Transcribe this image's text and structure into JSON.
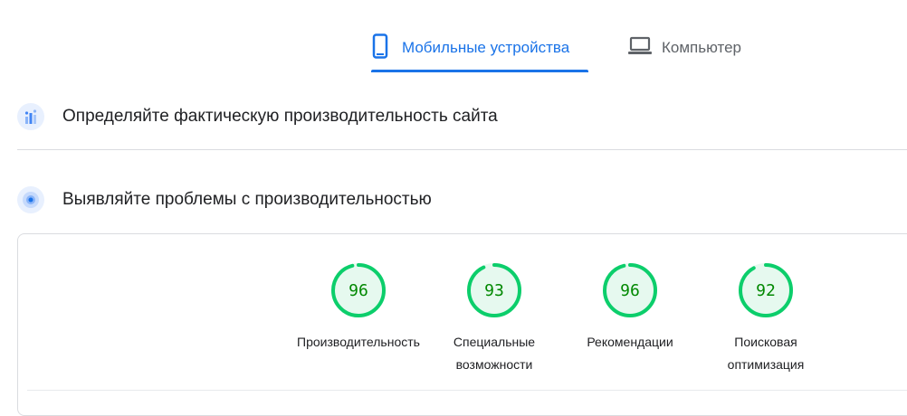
{
  "tabs": {
    "mobile": {
      "label": "Мобильные устройства",
      "icon": "smartphone-icon",
      "active": true
    },
    "desktop": {
      "label": "Компьютер",
      "icon": "laptop-icon",
      "active": false
    }
  },
  "sections": [
    {
      "title": "Определяйте фактическую производительность сайта",
      "icon": "field-data-icon"
    },
    {
      "title": "Выявляйте проблемы с производительностью",
      "icon": "lab-data-icon"
    }
  ],
  "scores": [
    {
      "value": 96,
      "label": "Производительность"
    },
    {
      "value": 93,
      "label": "Специальные возможности"
    },
    {
      "value": 96,
      "label": "Рекомендации"
    },
    {
      "value": 92,
      "label": "Поисковая оптимизация"
    }
  ],
  "colors": {
    "accent": "#1a73e8",
    "pass_ring": "#0cce6b",
    "pass_fill": "#e6f9ef",
    "pass_text": "#008800"
  }
}
